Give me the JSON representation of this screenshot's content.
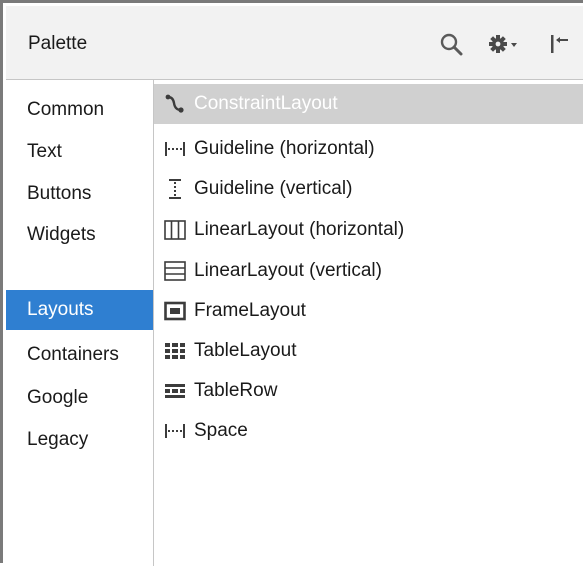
{
  "palette": {
    "title": "Palette",
    "tools": [
      {
        "name": "search-icon"
      },
      {
        "name": "gear-dropdown-icon"
      },
      {
        "name": "hide-panel-icon"
      }
    ],
    "categories": [
      {
        "label": "Common",
        "selected": false
      },
      {
        "label": "Text",
        "selected": false
      },
      {
        "label": "Buttons",
        "selected": false
      },
      {
        "label": "Widgets",
        "selected": false
      },
      {
        "label": "Layouts",
        "selected": true
      },
      {
        "label": "Containers",
        "selected": false
      },
      {
        "label": "Google",
        "selected": false
      },
      {
        "label": "Legacy",
        "selected": false
      }
    ],
    "items": [
      {
        "label": "ConstraintLayout",
        "icon": "constraint-layout-icon",
        "selected": true
      },
      {
        "label": "Guideline (horizontal)",
        "icon": "guideline-horizontal-icon",
        "selected": false
      },
      {
        "label": "Guideline (vertical)",
        "icon": "guideline-vertical-icon",
        "selected": false
      },
      {
        "label": "LinearLayout (horizontal)",
        "icon": "linear-layout-horizontal-icon",
        "selected": false
      },
      {
        "label": "LinearLayout (vertical)",
        "icon": "linear-layout-vertical-icon",
        "selected": false
      },
      {
        "label": "FrameLayout",
        "icon": "frame-layout-icon",
        "selected": false
      },
      {
        "label": "TableLayout",
        "icon": "table-layout-icon",
        "selected": false
      },
      {
        "label": "TableRow",
        "icon": "table-row-icon",
        "selected": false
      },
      {
        "label": "Space",
        "icon": "space-icon",
        "selected": false
      }
    ],
    "colors": {
      "header_bg": "#f2f2f2",
      "selected_category_bg": "#2f7fd1",
      "selected_item_bg": "#d0d0d0",
      "icon_color": "#3c3c3c"
    }
  }
}
